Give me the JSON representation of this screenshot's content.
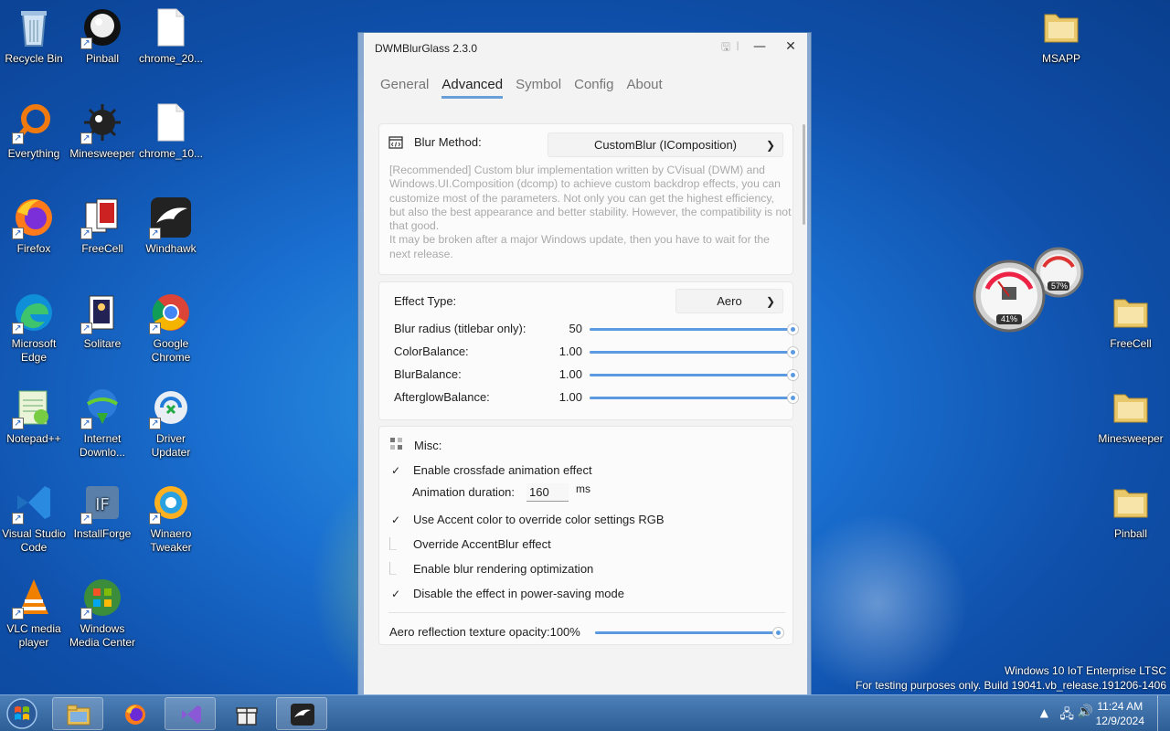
{
  "desktop_icons_left": [
    {
      "label": "Recycle Bin",
      "icon": "recycle-bin-icon"
    },
    {
      "label": "Pinball",
      "icon": "pinball-icon"
    },
    {
      "label": "chrome_20...",
      "icon": "file-icon"
    },
    {
      "label": "Everything",
      "icon": "everything-icon"
    },
    {
      "label": "Minesweeper",
      "icon": "minesweeper-icon"
    },
    {
      "label": "chrome_10...",
      "icon": "file-icon"
    },
    {
      "label": "Firefox",
      "icon": "firefox-icon"
    },
    {
      "label": "FreeCell",
      "icon": "freecell-icon"
    },
    {
      "label": "Windhawk",
      "icon": "windhawk-icon"
    },
    {
      "label": "Microsoft Edge",
      "icon": "edge-icon"
    },
    {
      "label": "Solitare",
      "icon": "solitaire-icon"
    },
    {
      "label": "Google Chrome",
      "icon": "chrome-icon"
    },
    {
      "label": "Notepad++",
      "icon": "notepadpp-icon"
    },
    {
      "label": "Internet Downlo...",
      "icon": "idm-icon"
    },
    {
      "label": "Driver Updater",
      "icon": "driver-updater-icon"
    },
    {
      "label": "Visual Studio Code",
      "icon": "vscode-icon"
    },
    {
      "label": "InstallForge",
      "icon": "installforge-icon"
    },
    {
      "label": "Winaero Tweaker",
      "icon": "winaero-icon"
    },
    {
      "label": "VLC media player",
      "icon": "vlc-icon"
    },
    {
      "label": "Windows Media Center",
      "icon": "media-center-icon"
    }
  ],
  "desktop_icons_right": [
    {
      "label": "MSAPP",
      "icon": "folder-icon"
    },
    {
      "label": "FreeCell",
      "icon": "folder-icon"
    },
    {
      "label": "Minesweeper",
      "icon": "folder-icon"
    },
    {
      "label": "Pinball",
      "icon": "folder-icon"
    }
  ],
  "gadget": {
    "cpu": "41%",
    "mem": "57%"
  },
  "window": {
    "title": "DWMBlurGlass 2.3.0",
    "tabs": [
      "General",
      "Advanced",
      "Symbol",
      "Config",
      "About"
    ],
    "active_tab": "Advanced",
    "blur_method": {
      "label": "Blur Method:",
      "value": "CustomBlur (IComposition)",
      "description": "[Recommended] Custom blur implementation written by CVisual (DWM) and Windows.UI.Composition (dcomp) to achieve custom backdrop effects, you can customize most of the parameters. Not only you can get the highest efficiency, but also the best appearance and better stability. However, the compatibility is not that good.",
      "description2": "It may be broken after a major Windows update, then you have to wait for the next release."
    },
    "effect": {
      "label": "Effect Type:",
      "value": "Aero",
      "sliders": [
        {
          "label": "Blur radius (titlebar only):",
          "value": "50",
          "fraction": 1.0
        },
        {
          "label": "ColorBalance:",
          "value": "1.00",
          "fraction": 1.0
        },
        {
          "label": "BlurBalance:",
          "value": "1.00",
          "fraction": 1.0
        },
        {
          "label": "AfterglowBalance:",
          "value": "1.00",
          "fraction": 1.0
        }
      ]
    },
    "misc": {
      "label": "Misc:",
      "crossfade": {
        "label": "Enable crossfade animation effect",
        "checked": true
      },
      "anim_duration": {
        "label": "Animation duration:",
        "value": "160",
        "unit": "ms"
      },
      "accent": {
        "label": "Use Accent color to override color settings RGB",
        "checked": true
      },
      "override": {
        "label": "Override AccentBlur effect",
        "checked": false
      },
      "optimization": {
        "label": "Enable blur rendering optimization",
        "checked": false
      },
      "powersave": {
        "label": "Disable the effect in power-saving mode",
        "checked": true
      },
      "reflection": {
        "label": "Aero reflection texture opacity:",
        "value": "100%",
        "fraction": 1.0
      }
    }
  },
  "watermark": {
    "line1": "Windows 10 IoT Enterprise LTSC",
    "line2": "For testing purposes only. Build 19041.vb_release.191206-1406"
  },
  "taskbar": {
    "items": [
      "file-explorer-icon",
      "firefox-icon",
      "visual-studio-icon",
      "gift-app-icon",
      "windhawk-icon"
    ],
    "time": "11:24 AM",
    "date": "12/9/2024"
  },
  "colors": {
    "accent": "#5b9ae0",
    "taskbar": "#3a6ea8"
  }
}
